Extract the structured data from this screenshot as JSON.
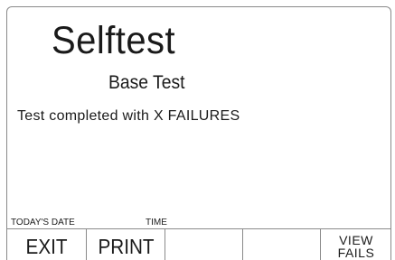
{
  "screen": {
    "title": "Selftest",
    "subtitle": "Base Test",
    "message": "Test completed with X FAILURES"
  },
  "footer": {
    "date_label": "TODAY'S DATE",
    "time_label": "TIME"
  },
  "softkeys": {
    "exit": "EXIT",
    "print": "PRINT",
    "key3": "",
    "key4": "",
    "view_fails_line1": "VIEW",
    "view_fails_line2": "FAILS"
  }
}
